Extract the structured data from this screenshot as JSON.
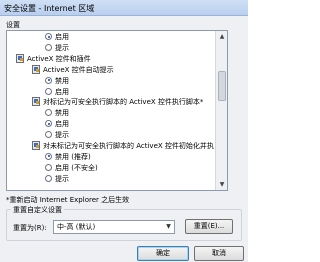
{
  "window": {
    "title": "安全设置 - Internet 区域"
  },
  "settings_label": "设置",
  "list": [
    {
      "kind": "radio",
      "label": "启用",
      "checked": true
    },
    {
      "kind": "radio",
      "label": "提示",
      "checked": false
    },
    {
      "kind": "category",
      "label": "ActiveX 控件和插件"
    },
    {
      "kind": "subcategory",
      "label": "ActiveX 控件自动提示"
    },
    {
      "kind": "radio",
      "label": "禁用",
      "checked": true
    },
    {
      "kind": "radio",
      "label": "启用",
      "checked": false
    },
    {
      "kind": "subcategory",
      "label": "对标记为可安全执行脚本的 ActiveX 控件执行脚本*"
    },
    {
      "kind": "radio",
      "label": "禁用",
      "checked": false
    },
    {
      "kind": "radio",
      "label": "启用",
      "checked": true
    },
    {
      "kind": "radio",
      "label": "提示",
      "checked": false
    },
    {
      "kind": "subcategory",
      "label": "对未标记为可安全执行脚本的 ActiveX 控件初始化并执"
    },
    {
      "kind": "radio",
      "label": "禁用 (推荐)",
      "checked": true
    },
    {
      "kind": "radio",
      "label": "启用 (不安全)",
      "checked": false
    },
    {
      "kind": "radio",
      "label": "提示",
      "checked": false
    }
  ],
  "note": "*重新启动 Internet Explorer 之后生效",
  "reset": {
    "group_title": "重置自定义设置",
    "to_label": "重置为(R):",
    "selected": "中-高 (默认)",
    "button": "重置(E)..."
  },
  "buttons": {
    "ok": "确定",
    "cancel": "取消"
  }
}
